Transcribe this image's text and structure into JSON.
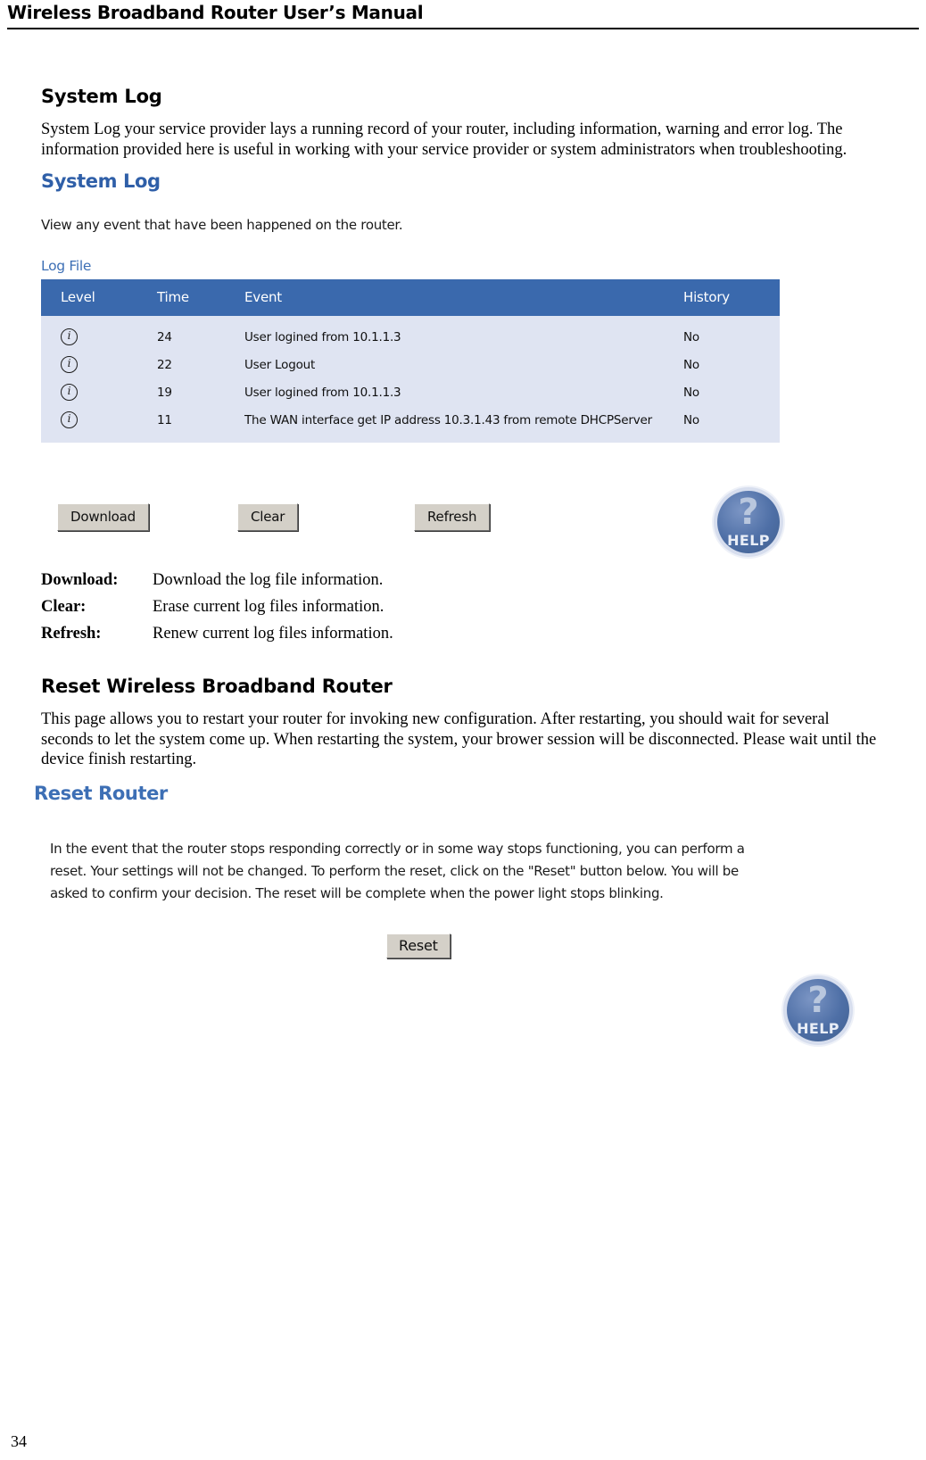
{
  "header": {
    "title": "Wireless Broadband Router User’s Manual"
  },
  "footer": {
    "page_number": "34"
  },
  "sections": [
    {
      "heading": "System Log",
      "paragraph": "System Log your service provider lays a running record of your router, including information, warning and error log. The information provided here is useful in working with your service provider or system administrators when troubleshooting."
    },
    {
      "heading": "Reset Wireless Broadband Router",
      "paragraph": "This page allows you to restart your router for invoking new configuration. After restarting, you should wait for several seconds to let the system come up. When restarting the system, your brower session will be disconnected. Please wait until the device finish restarting."
    }
  ],
  "system_log_ui": {
    "title": "System Log",
    "subtitle": "View any event that have been happened on the router.",
    "group_label": "Log File",
    "columns": [
      "Level",
      "Time",
      "Event",
      "History"
    ],
    "rows": [
      {
        "level_icon": "info-icon",
        "time": "24",
        "event": "User logined from 10.1.1.3",
        "history": "No"
      },
      {
        "level_icon": "info-icon",
        "time": "22",
        "event": "User Logout",
        "history": "No"
      },
      {
        "level_icon": "info-icon",
        "time": "19",
        "event": "User logined from 10.1.1.3",
        "history": "No"
      },
      {
        "level_icon": "info-icon",
        "time": "11",
        "event": "The WAN interface get IP address 10.3.1.43 from remote DHCPServer",
        "history": "No"
      }
    ],
    "buttons": {
      "download": "Download",
      "clear": "Clear",
      "refresh": "Refresh"
    },
    "help_badge": {
      "mark": "?",
      "label": "HELP"
    },
    "colors": {
      "title_blue": "#2f5fa8",
      "header_blue": "#3a69ad",
      "row_bg": "#dfe4f2",
      "button_face": "#d4d0c8"
    }
  },
  "descriptions": [
    {
      "term": "Download:",
      "text": "Download the log file information."
    },
    {
      "term": "Clear:",
      "text": "Erase current log files information."
    },
    {
      "term": "Refresh:",
      "text": "Renew current log files information."
    }
  ],
  "reset_router_ui": {
    "title": "Reset Router",
    "body": "In the event that the router stops responding correctly or in some way stops functioning, you can perform a reset. Your settings will not be changed. To perform the reset, click on the \"Reset\" button below. You will be asked to confirm your decision. The reset will be complete when the power light stops blinking.",
    "reset_button": "Reset",
    "help_badge": {
      "mark": "?",
      "label": "HELP"
    },
    "colors": {
      "title_blue": "#3d6fb5",
      "button_face": "#d4d0c8"
    }
  }
}
